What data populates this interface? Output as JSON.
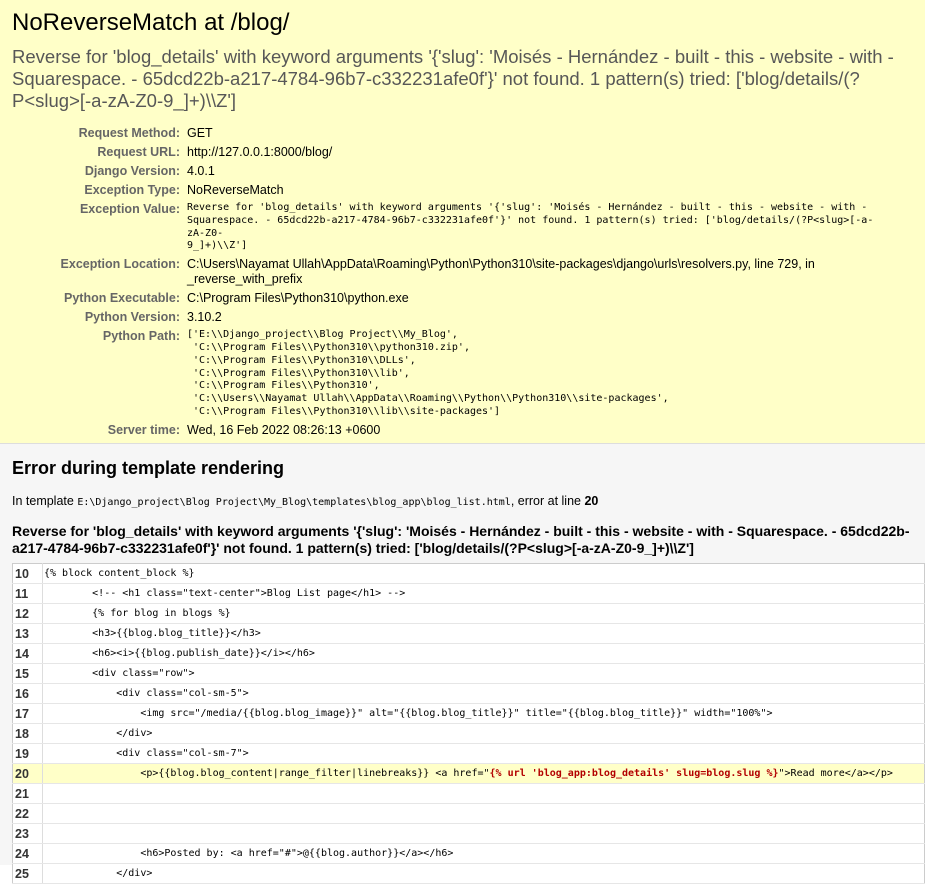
{
  "summary": {
    "title": "NoReverseMatch at /blog/",
    "exception_message": "Reverse for 'blog_details' with keyword arguments '{'slug': 'Moisés - Hernández - built - this - website - with - Squarespace. - 65dcd22b-a217-4784-96b7-c332231afe0f'}' not found. 1 pattern(s) tried: ['blog/details/(?P<slug>[-a-zA-Z0-9_]+)\\\\Z']",
    "rows": [
      {
        "label": "Request Method:",
        "value": "GET"
      },
      {
        "label": "Request URL:",
        "value": "http://127.0.0.1:8000/blog/"
      },
      {
        "label": "Django Version:",
        "value": "4.0.1"
      },
      {
        "label": "Exception Type:",
        "value": "NoReverseMatch"
      },
      {
        "label": "Exception Value:",
        "value": "Reverse for 'blog_details' with keyword arguments '{'slug': 'Moisés - Hernández - built - this - website - with -\nSquarespace. - 65dcd22b-a217-4784-96b7-c332231afe0f'}' not found. 1 pattern(s) tried: ['blog/details/(?P<slug>[-a-zA-Z0-\n9_]+)\\\\Z']"
      },
      {
        "label": "Exception Location:",
        "value": "C:\\Users\\Nayamat Ullah\\AppData\\Roaming\\Python\\Python310\\site-packages\\django\\urls\\resolvers.py, line 729, in _reverse_with_prefix"
      },
      {
        "label": "Python Executable:",
        "value": "C:\\Program Files\\Python310\\python.exe"
      },
      {
        "label": "Python Version:",
        "value": "3.10.2"
      },
      {
        "label": "Python Path:",
        "value": "['E:\\\\Django_project\\\\Blog Project\\\\My_Blog',\n 'C:\\\\Program Files\\\\Python310\\\\python310.zip',\n 'C:\\\\Program Files\\\\Python310\\\\DLLs',\n 'C:\\\\Program Files\\\\Python310\\\\lib',\n 'C:\\\\Program Files\\\\Python310',\n 'C:\\\\Users\\\\Nayamat Ullah\\\\AppData\\\\Roaming\\\\Python\\\\Python310\\\\site-packages',\n 'C:\\\\Program Files\\\\Python310\\\\lib\\\\site-packages']"
      },
      {
        "label": "Server time:",
        "value": "Wed, 16 Feb 2022 08:26:13 +0600"
      }
    ]
  },
  "template": {
    "heading": "Error during template rendering",
    "in_template_prefix": "In template ",
    "template_path": "E:\\Django_project\\Blog Project\\My_Blog\\templates\\blog_app\\blog_list.html",
    "error_at_text": ", error at line ",
    "error_line": "20",
    "error_message": "Reverse for 'blog_details' with keyword arguments '{'slug': 'Moisés - Hernández - built - this - website - with - Squarespace. - 65dcd22b-a217-4784-96b7-c332231afe0f'}' not found. 1 pattern(s) tried: ['blog/details/(?P<slug>[-a-zA-Z0-9_]+)\\\\Z']",
    "source_lines": [
      {
        "num": "10",
        "code": "{% block content_block %}"
      },
      {
        "num": "11",
        "code": "        <!-- <h1 class=\"text-center\">Blog List page</h1> -->"
      },
      {
        "num": "12",
        "code": "        {% for blog in blogs %}"
      },
      {
        "num": "13",
        "code": "        <h3>{{blog.blog_title}}</h3>"
      },
      {
        "num": "14",
        "code": "        <h6><i>{{blog.publish_date}}</i></h6>"
      },
      {
        "num": "15",
        "code": "        <div class=\"row\">"
      },
      {
        "num": "16",
        "code": "            <div class=\"col-sm-5\">"
      },
      {
        "num": "17",
        "code": "                <img src=\"/media/{{blog.blog_image}}\" alt=\"{{blog.blog_title}}\" title=\"{{blog.blog_title}}\" width=\"100%\">"
      },
      {
        "num": "18",
        "code": "            </div>"
      },
      {
        "num": "19",
        "code": "            <div class=\"col-sm-7\">"
      },
      {
        "num": "20",
        "code_before": "                <p>{{blog.blog_content|range_filter|linebreaks}} <a href=\"",
        "code_error": "{% url 'blog_app:blog_details' slug=blog.slug %}",
        "code_after": "\">Read more</a></p>"
      },
      {
        "num": "21",
        "code": ""
      },
      {
        "num": "22",
        "code": ""
      },
      {
        "num": "23",
        "code": ""
      },
      {
        "num": "24",
        "code": "                <h6>Posted by: <a href=\"#\">@{{blog.author}}</a></h6>"
      },
      {
        "num": "25",
        "code": "            </div>"
      }
    ]
  }
}
